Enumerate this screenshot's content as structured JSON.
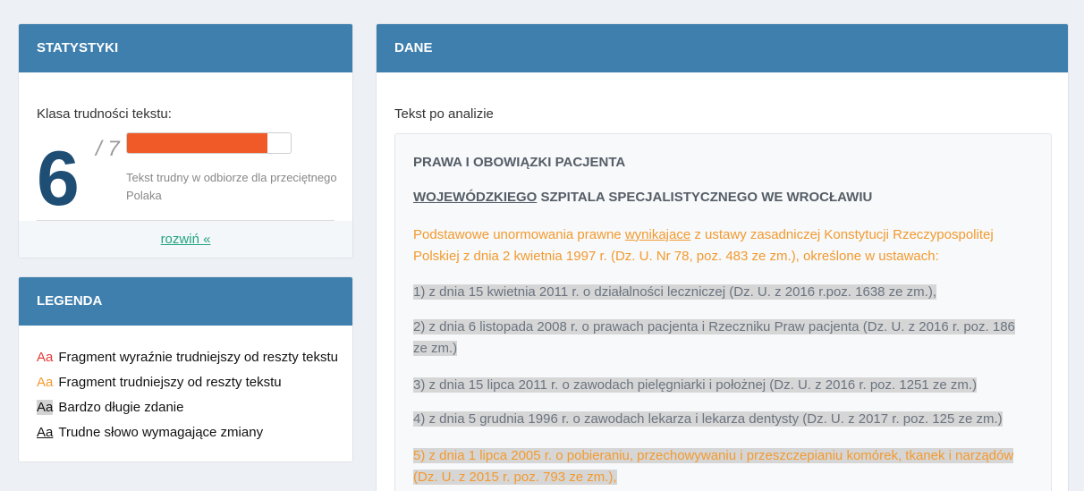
{
  "statystyki": {
    "header": "STATYSTYKI",
    "label": "Klasa trudności tekstu:",
    "score": "6",
    "max": "/ 7",
    "progress_fraction": 0.857,
    "progress_color": "#f05a28",
    "description": "Tekst trudny w odbiorze dla przeciętnego Polaka",
    "expand_link": "rozwiń «"
  },
  "legenda": {
    "header": "LEGENDA",
    "items": [
      {
        "sample": "Aa",
        "label": "Fragment wyraźnie trudniejszy od reszty tekstu",
        "style": "red"
      },
      {
        "sample": "Aa",
        "label": "Fragment trudniejszy od reszty tekstu",
        "style": "orange"
      },
      {
        "sample": "Aa",
        "label": "Bardzo długie zdanie",
        "style": "gray"
      },
      {
        "sample": "Aa",
        "label": "Trudne słowo wymagające zmiany",
        "style": "underline"
      }
    ]
  },
  "dane": {
    "header": "DANE",
    "subtitle": "Tekst po analizie",
    "heading1": "PRAWA I OBOWIĄZKI PACJENTA",
    "heading2_underlined": "WOJEWÓDZKIEGO",
    "heading2_rest": " SZPITALA SPECJALISTYCZNEGO WE WROCŁAWIU",
    "intro_part1": "Podstawowe unormowania prawne ",
    "intro_underlined": "wynikajace",
    "intro_part2": " z ustawy zasadniczej Konstytucji Rzeczypospolitej",
    "intro_line2": "Polskiej z dnia 2 kwietnia 1997 r. (Dz. U. Nr 78, poz. 483 ze zm.), określone w ustawach:",
    "item1": "1) z dnia 15 kwietnia 2011 r. o działalności leczniczej (Dz. U. z 2016 r.poz. 1638 ze zm.),",
    "item2_line1": "2) z dnia 6 listopada 2008 r. o prawach pacjenta i Rzeczniku Praw pacjenta (Dz. U. z 2016 r. poz. 186",
    "item2_line2": "ze zm.)",
    "item3": "3) z dnia 15 lipca 2011 r. o zawodach pielęgniarki i położnej (Dz. U. z 2016 r. poz. 1251 ze zm.)",
    "item4": "4) z dnia 5 grudnia 1996 r. o zawodach lekarza i lekarza dentysty (Dz. U. z 2017 r. poz. 125 ze zm.)",
    "item5_line1": "5) z dnia 1 lipca 2005 r. o pobieraniu, przechowywaniu i przeszczepianiu komórek, tkanek i narządów",
    "item5_line2": "(Dz. U. z 2015 r. poz. 793 ze zm.),"
  }
}
